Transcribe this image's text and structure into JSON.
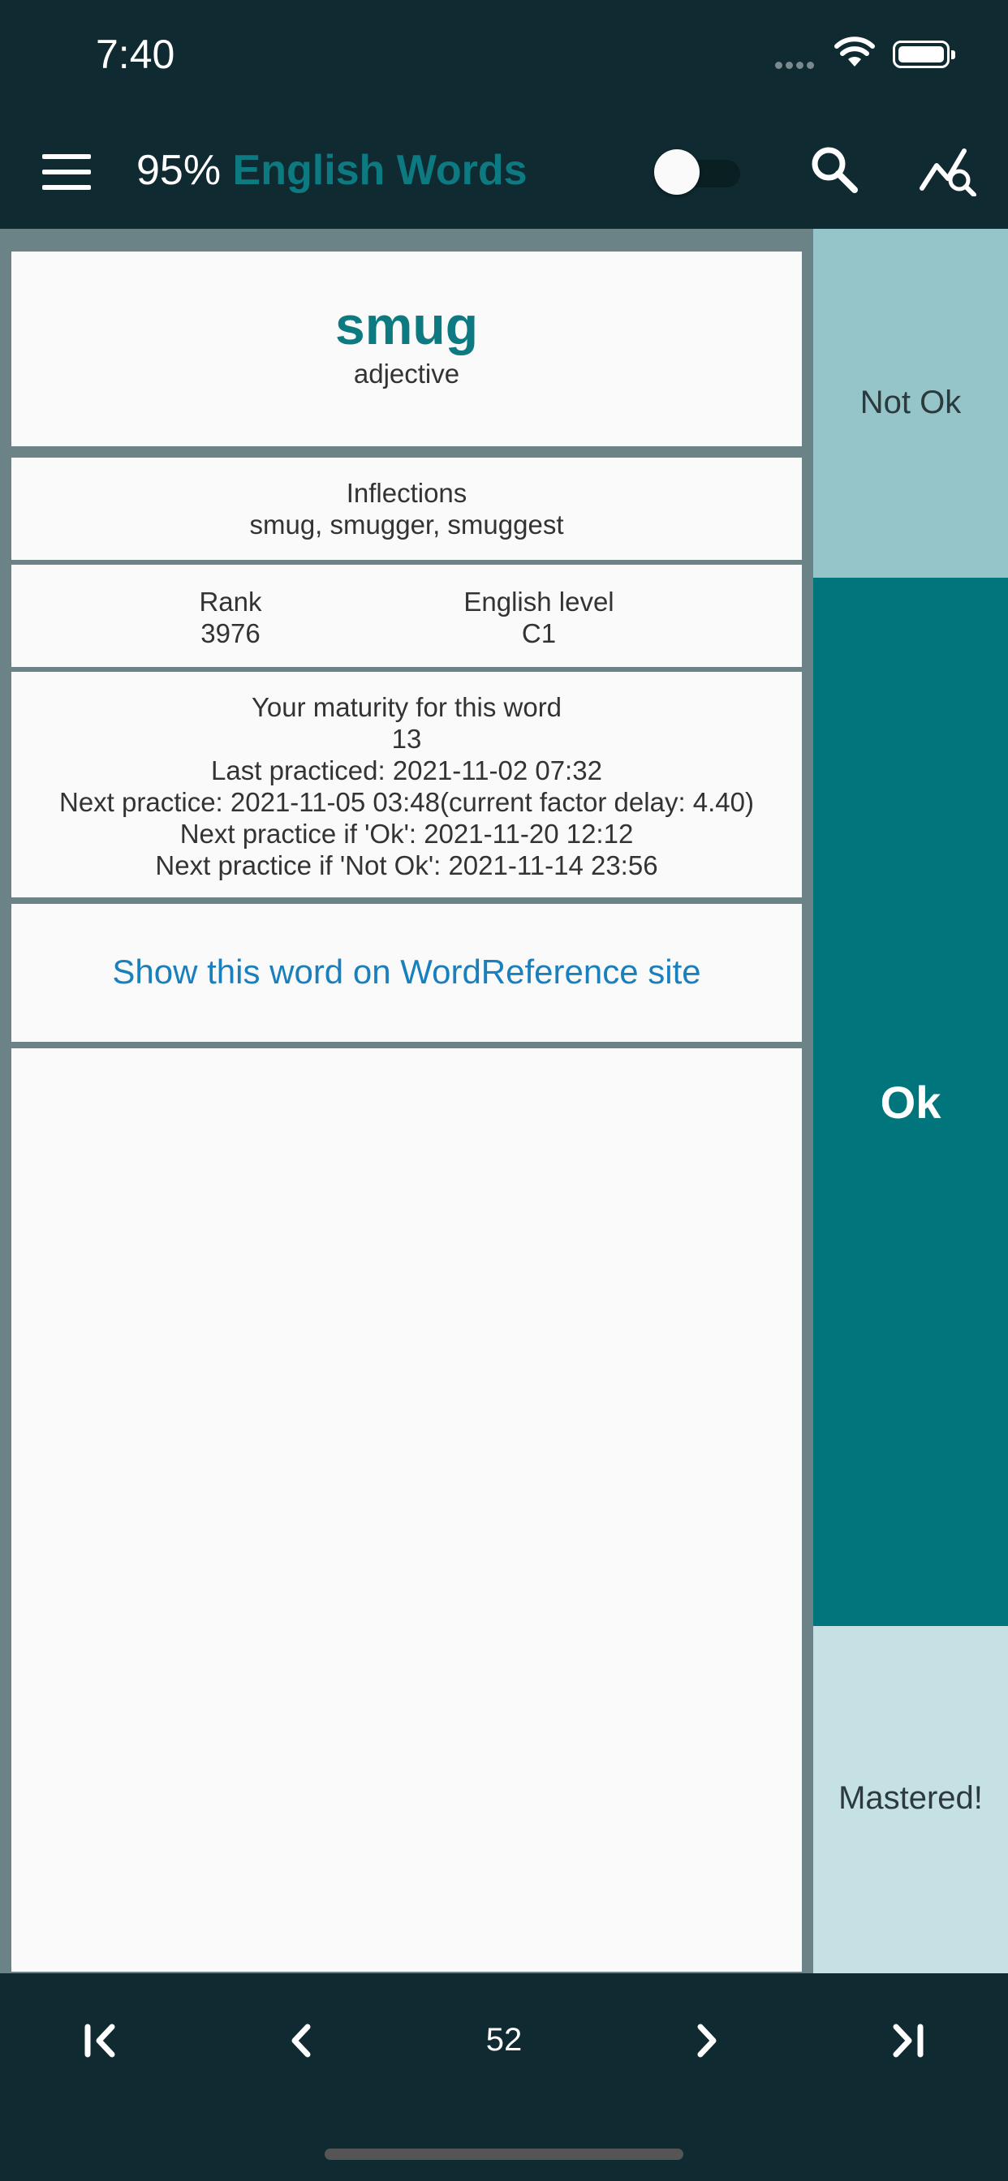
{
  "status_bar": {
    "time": "7:40"
  },
  "app_bar": {
    "percent": "95%",
    "app_name": "English Words",
    "toggle_on": false
  },
  "word_card": {
    "word": "smug",
    "part_of_speech": "adjective"
  },
  "inflections": {
    "label": "Inflections",
    "value": "smug, smugger, smuggest"
  },
  "stats": {
    "rank_label": "Rank",
    "rank": "3976",
    "level_label": "English level",
    "level": "C1"
  },
  "maturity": {
    "title": "Your maturity for this word",
    "value": "13",
    "last_practiced": "Last practiced: 2021-11-02 07:32",
    "next_practice": "Next practice: 2021-11-05 03:48(current factor delay: 4.40)",
    "next_if_ok": "Next practice if 'Ok': 2021-11-20 12:12",
    "next_if_not_ok": "Next practice if 'Not Ok': 2021-11-14 23:56"
  },
  "link": {
    "label": "Show this word on WordReference site"
  },
  "actions": {
    "not_ok": "Not Ok",
    "ok": "Ok",
    "mastered": "Mastered!"
  },
  "pagination": {
    "page": "52"
  },
  "colors": {
    "primary_dark": "#0f2a30",
    "accent_teal": "#00757c",
    "link_blue": "#1a7fbd",
    "not_ok_bg": "#95c5c9",
    "mastered_bg": "#c6e1e3"
  },
  "icons": {
    "menu": "menu-icon",
    "search": "search-icon",
    "stats": "chart-search-icon",
    "first": "first-page-icon",
    "prev": "chevron-left-icon",
    "next": "chevron-right-icon",
    "last": "last-page-icon"
  }
}
